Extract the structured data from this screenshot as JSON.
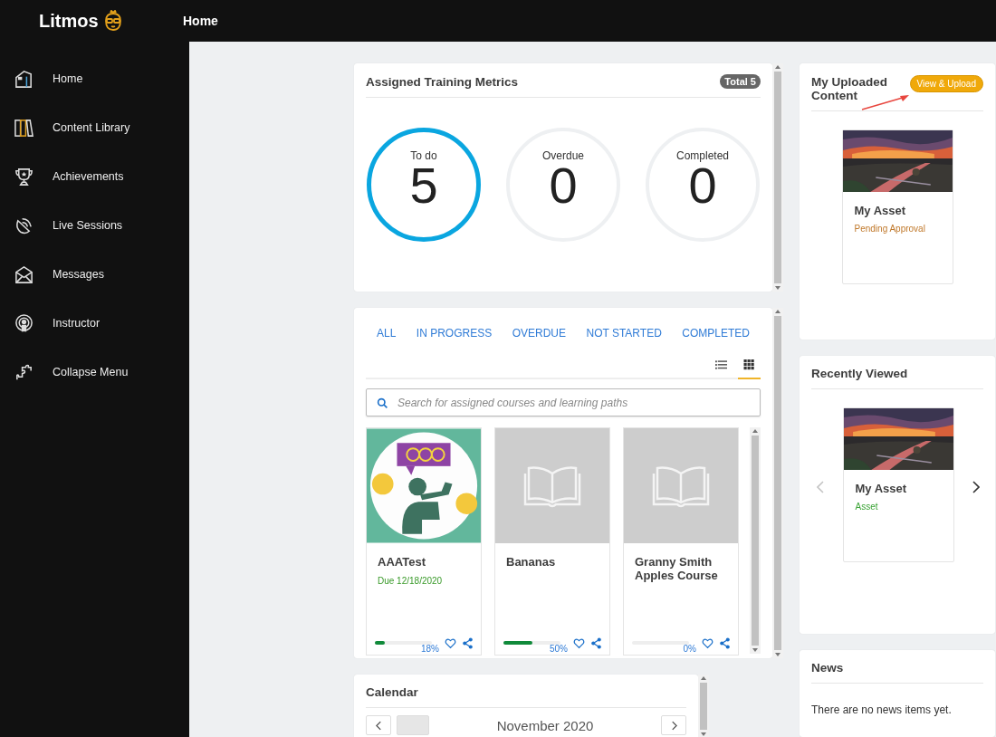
{
  "topbar": {
    "logo": "Litmos",
    "title": "Home"
  },
  "sidebar": {
    "items": [
      {
        "label": "Home"
      },
      {
        "label": "Content Library"
      },
      {
        "label": "Achievements"
      },
      {
        "label": "Live Sessions"
      },
      {
        "label": "Messages"
      },
      {
        "label": "Instructor"
      },
      {
        "label": "Collapse Menu"
      }
    ]
  },
  "metrics": {
    "title": "Assigned Training Metrics",
    "total": "Total 5",
    "items": [
      {
        "label": "To do",
        "value": "5",
        "highlighted": true
      },
      {
        "label": "Overdue",
        "value": "0",
        "highlighted": false
      },
      {
        "label": "Completed",
        "value": "0",
        "highlighted": false
      }
    ]
  },
  "courses": {
    "filters": [
      "ALL",
      "IN PROGRESS",
      "OVERDUE",
      "NOT STARTED",
      "COMPLETED"
    ],
    "views": [
      {
        "kind": "list",
        "selected": false
      },
      {
        "kind": "grid",
        "selected": true
      }
    ],
    "search": {
      "placeholder": "Search for assigned courses and learning paths"
    },
    "items": [
      {
        "title": "AAATest",
        "due": "Due 12/18/2020",
        "kind": "illustration",
        "level": 0.18,
        "percent": "18%"
      },
      {
        "title": "Bananas",
        "kind": "book",
        "level": 0.5,
        "percent": "50%"
      },
      {
        "title": "Granny Smith Apples Course",
        "kind": "book",
        "level": 0,
        "percent": "0%"
      }
    ]
  },
  "calendar": {
    "title": "Calendar",
    "month": "November 2020"
  },
  "uploaded": {
    "title": "My Uploaded Content",
    "button": "View & Upload",
    "asset": {
      "title": "My Asset",
      "status": "Pending Approval",
      "kind": "pending"
    }
  },
  "recent": {
    "title": "Recently Viewed",
    "prev_disabled": true,
    "next_disabled": false,
    "asset": {
      "title": "My Asset",
      "status": "Asset",
      "kind": "type"
    }
  },
  "news": {
    "title": "News",
    "message": "There are no news items yet."
  }
}
